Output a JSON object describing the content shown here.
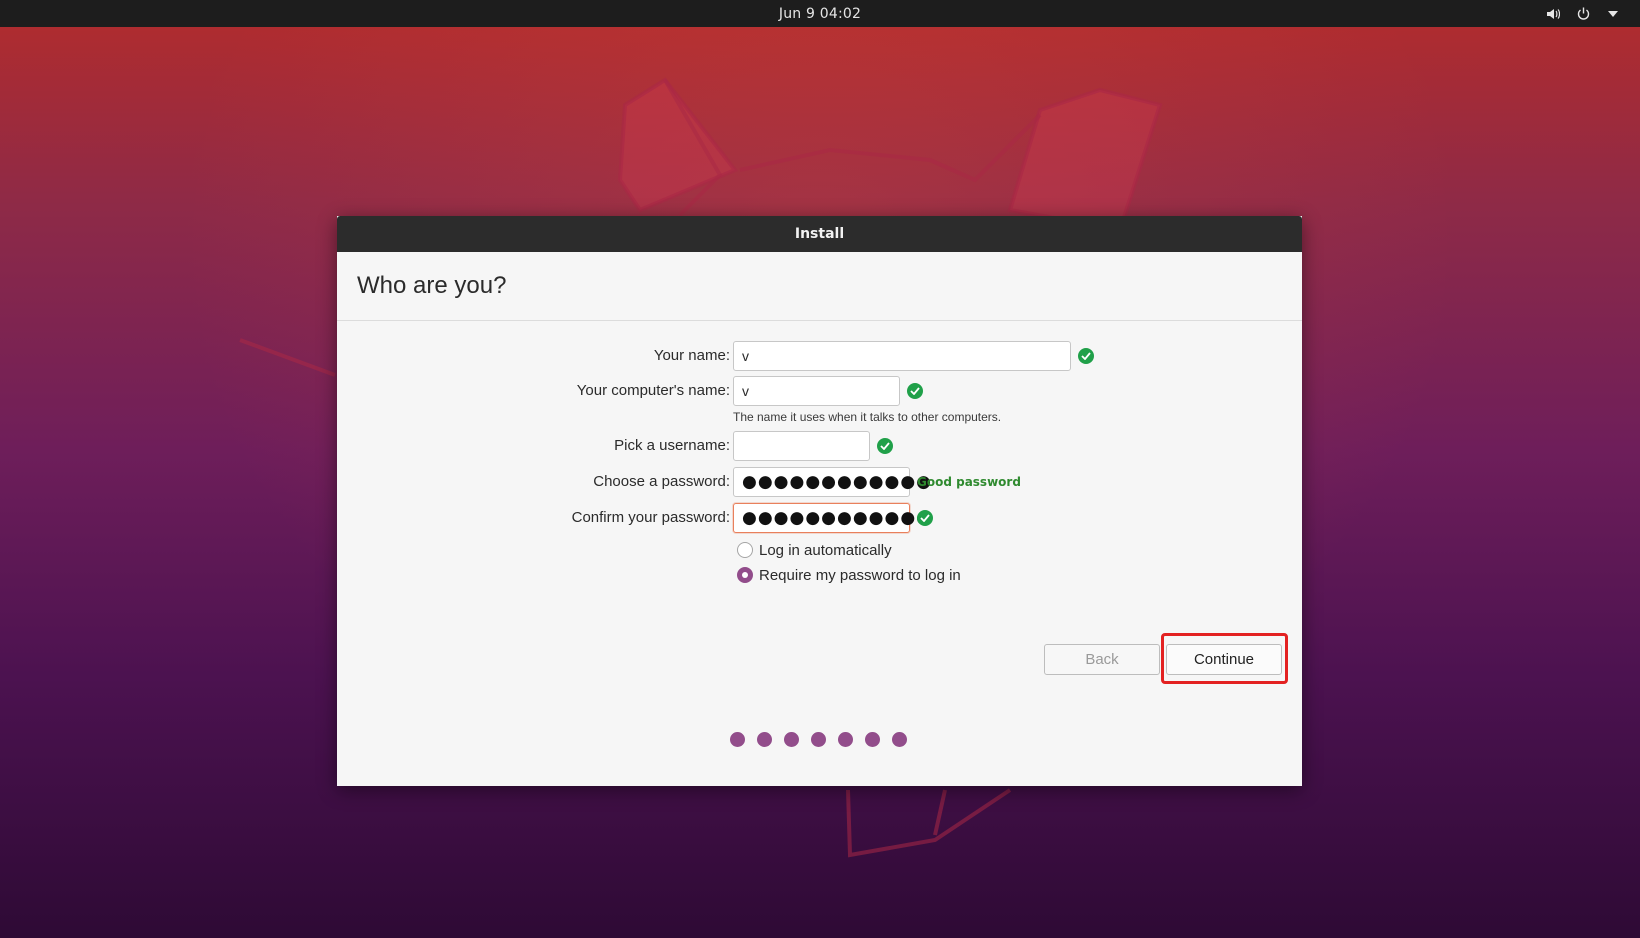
{
  "topbar": {
    "clock": "Jun 9  04:02",
    "icons": [
      "speaker-icon",
      "power-icon",
      "menu-arrow-icon"
    ]
  },
  "window": {
    "title": "Install",
    "heading": "Who are you?"
  },
  "form": {
    "your_name": {
      "label": "Your name:",
      "value": "v"
    },
    "computer_name": {
      "label": "Your computer's name:",
      "value": "v",
      "hint": "The name it uses when it talks to other computers."
    },
    "username": {
      "label": "Pick a username:",
      "value": ""
    },
    "password": {
      "label": "Choose a password:",
      "masked": "●●●●●●●●●●●●",
      "strength": "Good password"
    },
    "confirm_password": {
      "label": "Confirm your password:",
      "masked": "●●●●●●●●●●●●"
    },
    "login_options": [
      {
        "label": "Log in automatically",
        "selected": false
      },
      {
        "label": "Require my password to log in",
        "selected": true
      }
    ]
  },
  "buttons": {
    "back": "Back",
    "continue": "Continue"
  },
  "progress": {
    "steps": 7
  },
  "colors": {
    "accent": "#924d8b",
    "valid": "#20a049",
    "highlight": "#e32121"
  }
}
